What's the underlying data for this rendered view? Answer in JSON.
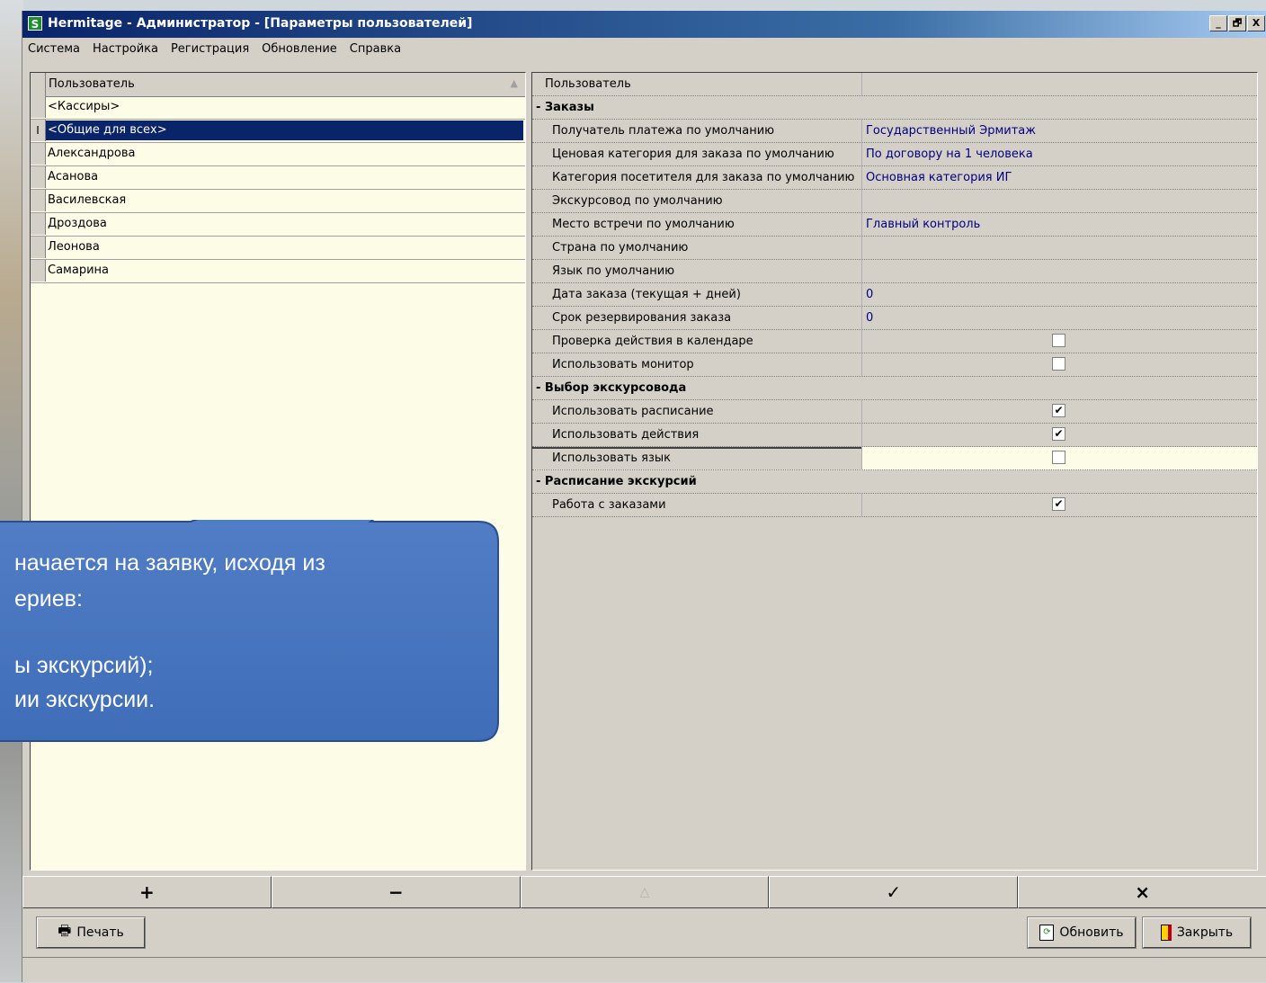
{
  "window": {
    "title": "Hermitage - Администратор - [Параметры пользователей]",
    "icon": "S",
    "controls": [
      "_",
      "🗗",
      "X"
    ]
  },
  "menu": [
    "Система",
    "Настройка",
    "Регистрация",
    "Обновление",
    "Справка"
  ],
  "users": {
    "header": "Пользователь",
    "rows": [
      {
        "label": "<Кассиры>",
        "indicator": ""
      },
      {
        "label": "<Общие для всех>",
        "indicator": "I"
      },
      {
        "label": "Александрова",
        "indicator": ""
      },
      {
        "label": "Асанова",
        "indicator": ""
      },
      {
        "label": "Василевская",
        "indicator": ""
      },
      {
        "label": "Дроздова",
        "indicator": ""
      },
      {
        "label": "Леонова",
        "indicator": ""
      },
      {
        "label": "Самарина",
        "indicator": ""
      }
    ],
    "selected_index": 1
  },
  "params": {
    "header": "Пользователь",
    "rows": [
      {
        "label": "- Заказы",
        "value": "",
        "type": "category"
      },
      {
        "label": "Получатель платежа по умолчанию",
        "value": "Государственный Эрмитаж",
        "type": "text"
      },
      {
        "label": "Ценовая категория для заказа по умолчанию",
        "value": "По договору на 1 человека",
        "type": "text"
      },
      {
        "label": "Категория посетителя для заказа по умолчанию",
        "value": "Основная категория ИГ",
        "type": "text"
      },
      {
        "label": "Экскурсовод по умолчанию",
        "value": "",
        "type": "text"
      },
      {
        "label": "Место встречи по умолчанию",
        "value": "Главный контроль",
        "type": "text"
      },
      {
        "label": "Страна по умолчанию",
        "value": "",
        "type": "text"
      },
      {
        "label": "Язык по умолчанию",
        "value": "",
        "type": "text"
      },
      {
        "label": "Дата заказа (текущая + дней)",
        "value": "0",
        "type": "text"
      },
      {
        "label": "Срок резервирования заказа",
        "value": "0",
        "type": "text"
      },
      {
        "label": "Проверка действия  в календаре",
        "checked": false,
        "type": "checkbox"
      },
      {
        "label": "Использовать монитор",
        "checked": false,
        "type": "checkbox"
      },
      {
        "label": "- Выбор экскурсовода",
        "value": "",
        "type": "category"
      },
      {
        "label": "Использовать расписание",
        "checked": true,
        "type": "checkbox"
      },
      {
        "label": "Использовать действия",
        "checked": true,
        "type": "checkbox"
      },
      {
        "label": "Использовать язык",
        "checked": false,
        "type": "checkbox",
        "active": true
      },
      {
        "label": "- Расписание экскурсий",
        "value": "",
        "type": "category"
      },
      {
        "label": "Работа с заказами",
        "checked": true,
        "type": "checkbox"
      }
    ]
  },
  "nav": {
    "add": "+",
    "remove": "−",
    "up": "△",
    "apply": "✓",
    "cancel": "×"
  },
  "buttons": {
    "print": "Печать",
    "refresh": "Обновить",
    "close": "Закрыть"
  },
  "callout": {
    "lines": [
      "начается на заявку, исходя из",
      "ериев:",
      "",
      "ы экскурсий);",
      "ии экскурсии."
    ],
    "color": "#4a78c2"
  }
}
